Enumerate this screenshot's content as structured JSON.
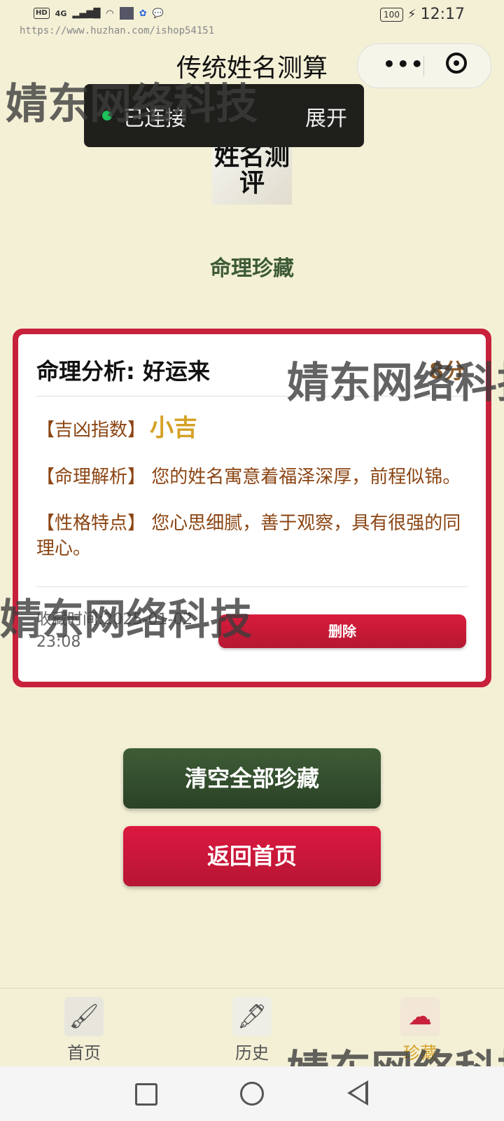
{
  "status_bar": {
    "network": "4G",
    "hd": "HD",
    "battery": "100",
    "time": "12:17"
  },
  "url_watermark": "https://www.huzhan.com/ishop54151",
  "nav": {
    "title": "传统姓名测算",
    "more_icon": "more-dots-icon",
    "close_icon": "target-close-icon"
  },
  "connection": {
    "status": "已连接",
    "expand": "展开",
    "status_color": "#1ec25b"
  },
  "watermark_text": "婧东网络科技",
  "logo_text": "姓名测评",
  "section_title": "命理珍藏",
  "card": {
    "title": "命理分析: 好运来",
    "score": "8分",
    "rows": [
      {
        "label": "【吉凶指数】",
        "value": "小吉"
      },
      {
        "label": "【命理解析】",
        "value": "您的姓名寓意着福泽深厚，前程似锦。"
      },
      {
        "label": "【性格特点】",
        "value": "您心思细腻，善于观察，具有很强的同理心。"
      }
    ],
    "time_line1": "收藏时间:2025-01-02",
    "time_line2": "23:08",
    "delete_label": "删除"
  },
  "buttons": {
    "clear_all": "清空全部珍藏",
    "back_home": "返回首页"
  },
  "tabs": [
    {
      "label": "首页",
      "icon": "brush-ink-icon"
    },
    {
      "label": "历史",
      "icon": "brush-stroke-icon"
    },
    {
      "label": "珍藏",
      "icon": "cloud-pattern-icon"
    }
  ],
  "colors": {
    "background": "#f3f0d6",
    "accent_red": "#c8213c",
    "accent_green": "#3e5c36",
    "gold": "#d4a124"
  }
}
